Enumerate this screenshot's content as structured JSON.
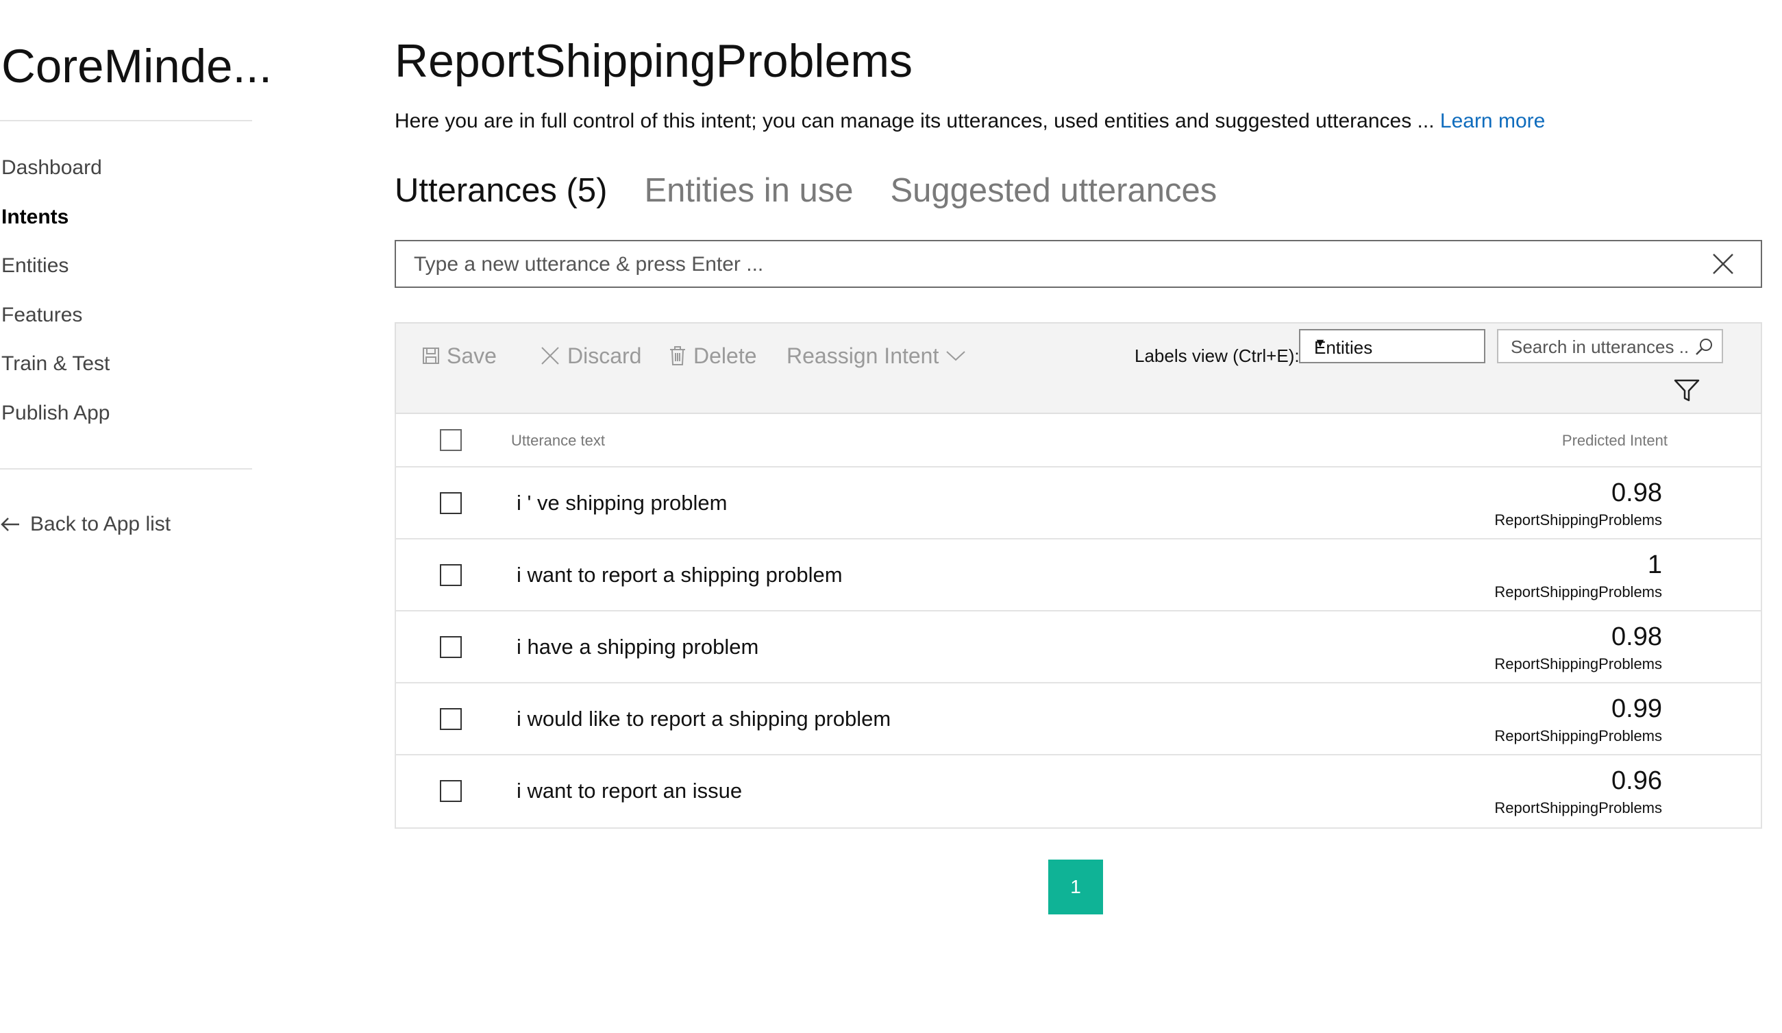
{
  "sidebar": {
    "app_name": "CoreMinde...",
    "nav": [
      {
        "label": "Dashboard",
        "active": false
      },
      {
        "label": "Intents",
        "active": true
      },
      {
        "label": "Entities",
        "active": false
      },
      {
        "label": "Features",
        "active": false
      },
      {
        "label": "Train & Test",
        "active": false
      },
      {
        "label": "Publish App",
        "active": false
      }
    ],
    "back_link": "Back to App list"
  },
  "header": {
    "title": "ReportShippingProblems",
    "description": "Here you are in full control of this intent; you can manage its utterances, used entities and suggested utterances ... ",
    "learn_more": "Learn more"
  },
  "tabs": [
    {
      "label": "Utterances (5)",
      "active": true
    },
    {
      "label": "Entities in use",
      "active": false
    },
    {
      "label": "Suggested utterances",
      "active": false
    }
  ],
  "utterance_input": {
    "placeholder": "Type a new utterance & press Enter ...",
    "value": ""
  },
  "toolbar": {
    "save_label": "Save",
    "discard_label": "Discard",
    "delete_label": "Delete",
    "reassign_label": "Reassign Intent",
    "labels_view_label": "Labels view (Ctrl+E):",
    "labels_view_value": "Entities",
    "search_placeholder": "Search in utterances ..."
  },
  "table": {
    "columns": {
      "utterance": "Utterance text",
      "predicted": "Predicted Intent"
    },
    "rows": [
      {
        "text": "i ' ve shipping problem",
        "score": "0.98",
        "intent": "ReportShippingProblems"
      },
      {
        "text": "i want to report a shipping problem",
        "score": "1",
        "intent": "ReportShippingProblems"
      },
      {
        "text": "i have a shipping problem",
        "score": "0.98",
        "intent": "ReportShippingProblems"
      },
      {
        "text": "i would like to report a shipping problem",
        "score": "0.99",
        "intent": "ReportShippingProblems"
      },
      {
        "text": "i want to report an issue",
        "score": "0.96",
        "intent": "ReportShippingProblems"
      }
    ]
  },
  "pagination": {
    "current": "1"
  },
  "colors": {
    "accent": "#0fb396",
    "link": "#0f6cbd"
  }
}
